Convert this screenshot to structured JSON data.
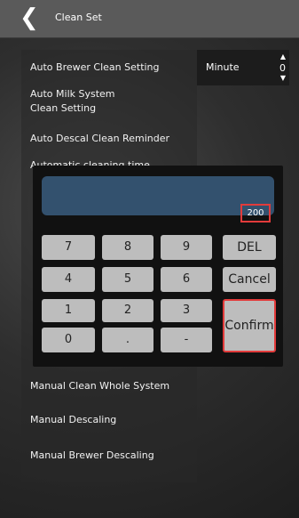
{
  "header": {
    "title": "Clean Set"
  },
  "settings": {
    "items": [
      "Auto Brewer Clean Setting",
      "Auto Milk System\nClean Setting",
      "Auto Descal Clean Reminder",
      "Automatic cleaning time",
      "Manual Clean Whole System",
      "Manual Descaling",
      "Manual Brewer Descaling"
    ]
  },
  "unit_panel": {
    "unit": "Minute",
    "value": "0"
  },
  "keypad": {
    "display": "200",
    "keys": {
      "k7": "7",
      "k8": "8",
      "k9": "9",
      "del": "DEL",
      "k4": "4",
      "k5": "5",
      "k6": "6",
      "cancel": "Cancel",
      "k1": "1",
      "k2": "2",
      "k3": "3",
      "confirm": "Confirm",
      "k0": "0",
      "dot": ".",
      "minus": "-"
    }
  },
  "icons": {
    "back": "chevron-left-icon",
    "spin_up": "triangle-up-icon",
    "spin_down": "triangle-down-icon"
  },
  "colors": {
    "header": "#5a5a5a",
    "display": "#33516e",
    "highlight": "#e23b3b",
    "key": "#bdbdbd"
  }
}
